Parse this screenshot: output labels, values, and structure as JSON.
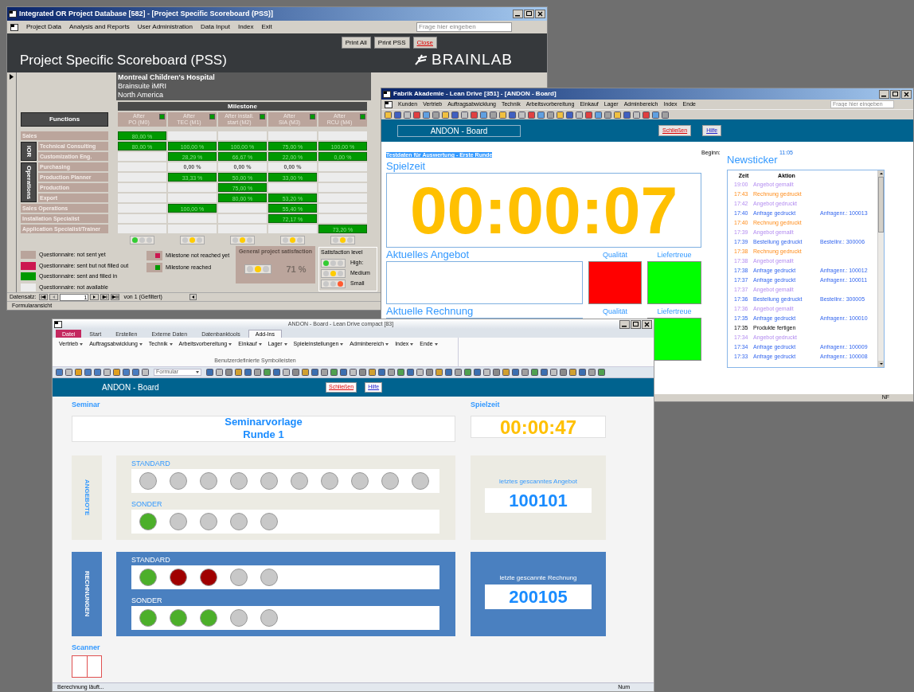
{
  "pss_window": {
    "title": "Integrated OR Project Database [582] - [Project Specific Scoreboard (PSS)]",
    "menu": [
      "Project Data",
      "Analysis and Reports",
      "User Administration",
      "Data Input",
      "Index",
      "Exit"
    ],
    "help_placeholder": "Frage hier eingeben",
    "buttons": [
      {
        "label": "Print All",
        "kind": "normal"
      },
      {
        "label": "Print PSS",
        "kind": "normal"
      },
      {
        "label": "Close",
        "kind": "close"
      }
    ],
    "heading": "Project Specific Scoreboard (PSS)",
    "logo": "BRAINLAB",
    "project": [
      "Montreal Children's Hospital",
      "Brainsuite iMRI",
      "North America"
    ],
    "milestone_header": "Milestone",
    "functions_header": "Functions",
    "milestones": [
      {
        "lines": [
          "After",
          "PO (M0)"
        ],
        "reached": true,
        "lights": [
          {
            "color": "#33cc33"
          },
          {
            "color": "#c8c8c8"
          },
          {
            "color": "#c8c8c8"
          }
        ]
      },
      {
        "lines": [
          "After",
          "TEC (M1)"
        ],
        "reached": true,
        "lights": [
          {
            "color": "#c8c8c8"
          },
          {
            "color": "#ffcc00"
          },
          {
            "color": "#c8c8c8"
          }
        ]
      },
      {
        "lines": [
          "After install.",
          "start (M2)"
        ],
        "reached": true,
        "lights": [
          {
            "color": "#c8c8c8"
          },
          {
            "color": "#ffcc00"
          },
          {
            "color": "#c8c8c8"
          }
        ]
      },
      {
        "lines": [
          "After",
          "SIA (M3)"
        ],
        "reached": true,
        "lights": [
          {
            "color": "#c8c8c8"
          },
          {
            "color": "#ffcc00"
          },
          {
            "color": "#c8c8c8"
          }
        ]
      },
      {
        "lines": [
          "After",
          "RCU (M4)"
        ],
        "reached": true,
        "lights": [
          {
            "color": "#c8c8c8"
          },
          {
            "color": "#ffcc00"
          },
          {
            "color": "#c8c8c8"
          }
        ]
      }
    ],
    "functions": [
      {
        "kind": "row",
        "label": "Sales",
        "cells": [
          {
            "color": "#009900",
            "text": "80,00 %"
          },
          {
            "color": "#ececec"
          },
          {
            "color": "#ececec"
          },
          {
            "color": "#ececec"
          },
          {
            "color": "#ececec"
          }
        ]
      },
      {
        "kind": "group",
        "label": "IOR",
        "children": [
          {
            "kind": "row",
            "label": "Technical Consulting",
            "cells": [
              {
                "color": "#009900",
                "text": "80,00 %"
              },
              {
                "color": "#009900",
                "text": "100,00 %"
              },
              {
                "color": "#009900",
                "text": "100,00 %"
              },
              {
                "color": "#009900",
                "text": "75,00 %"
              },
              {
                "color": "#009900",
                "text": "100,00 %"
              }
            ]
          },
          {
            "kind": "row",
            "label": "Customization Eng.",
            "cells": [
              {
                "color": "#ececec"
              },
              {
                "color": "#009900",
                "text": "28,29 %"
              },
              {
                "color": "#009900",
                "text": "66,67 %"
              },
              {
                "color": "#009900",
                "text": "22,00 %"
              },
              {
                "color": "#009900",
                "text": "0,00 %"
              }
            ]
          }
        ]
      },
      {
        "kind": "group",
        "label": "Operations",
        "children": [
          {
            "kind": "row",
            "label": "Purchasing",
            "cells": [
              {
                "color": "#ececec"
              },
              {
                "color": "#ececec",
                "text": "0,00 %"
              },
              {
                "color": "#ececec",
                "text": "0,00 %"
              },
              {
                "color": "#ececec",
                "text": "0,00 %"
              },
              {
                "color": "#ececec"
              }
            ]
          },
          {
            "kind": "row",
            "label": "Production Planner",
            "cells": [
              {
                "color": "#ececec"
              },
              {
                "color": "#009900",
                "text": "33,33 %"
              },
              {
                "color": "#009900",
                "text": "50,00 %"
              },
              {
                "color": "#009900",
                "text": "33,00 %"
              },
              {
                "color": "#ececec"
              }
            ]
          },
          {
            "kind": "row",
            "label": "Production",
            "cells": [
              {
                "color": "#ececec"
              },
              {
                "color": "#ececec"
              },
              {
                "color": "#009900",
                "text": "75,00 %"
              },
              {
                "color": "#ececec"
              },
              {
                "color": "#ececec"
              }
            ]
          },
          {
            "kind": "row",
            "label": "Export",
            "cells": [
              {
                "color": "#ececec"
              },
              {
                "color": "#ececec"
              },
              {
                "color": "#009900",
                "text": "80,00 %"
              },
              {
                "color": "#009900",
                "text": "53,20 %"
              },
              {
                "color": "#ececec"
              }
            ]
          }
        ]
      },
      {
        "kind": "row",
        "label": "Sales Operations",
        "cells": [
          {
            "color": "#ececec"
          },
          {
            "color": "#009900",
            "text": "100,00 %"
          },
          {
            "color": "#ececec"
          },
          {
            "color": "#009900",
            "text": "55,40 %"
          },
          {
            "color": "#ececec"
          }
        ]
      },
      {
        "kind": "row",
        "label": "Installation Specialist",
        "cells": [
          {
            "color": "#ececec"
          },
          {
            "color": "#ececec"
          },
          {
            "color": "#ececec"
          },
          {
            "color": "#009900",
            "text": "72,17 %"
          },
          {
            "color": "#ececec"
          }
        ]
      },
      {
        "kind": "row",
        "label": "Application Specialist/Trainer",
        "cells": [
          {
            "color": "#ececec"
          },
          {
            "color": "#ececec"
          },
          {
            "color": "#ececec"
          },
          {
            "color": "#ececec"
          },
          {
            "color": "#009900",
            "text": "73,20 %"
          }
        ]
      }
    ],
    "legend": [
      {
        "color": "#b9a49b",
        "text": "Questionnaire: not sent yet"
      },
      {
        "color": "#cc1650",
        "text": "Questionnaire: sent but not filled out"
      },
      {
        "color": "#009900",
        "text": "Questionnaire: sent and filled in"
      },
      {
        "color": "#ececec",
        "text": "Questionnaire: not available"
      }
    ],
    "milestone_legend": [
      {
        "color": "#cc1650",
        "text": "Milestone not reached yet"
      },
      {
        "color": "#009900",
        "text": "Milestone reached"
      }
    ],
    "general_satisfaction": {
      "title": "General project satisfaction",
      "lights": [
        {
          "color": "#c8c8c8"
        },
        {
          "color": "#ffcc00"
        },
        {
          "color": "#c8c8c8"
        }
      ],
      "value": "71 %"
    },
    "satisfaction_level": {
      "title": "Satisfaction level",
      "levels": [
        {
          "label": "High:",
          "lights": [
            {
              "color": "#33cc33"
            },
            {
              "color": "#c8c8c8"
            },
            {
              "color": "#c8c8c8"
            }
          ]
        },
        {
          "label": "Medium",
          "lights": [
            {
              "color": "#c8c8c8"
            },
            {
              "color": "#ffcc00"
            },
            {
              "color": "#c8c8c8"
            }
          ]
        },
        {
          "label": "Small",
          "lights": [
            {
              "color": "#c8c8c8"
            },
            {
              "color": "#c8c8c8"
            },
            {
              "color": "#ff5a30"
            }
          ]
        }
      ]
    },
    "record_nav": {
      "label": "Datensatz:",
      "value": "1",
      "total": "von  1 (Gefiltert)"
    },
    "status": "Formularansicht"
  },
  "andon_window": {
    "title": "Fabrik Akademie - Lean Drive [351] - [ANDON - Board]",
    "menu": [
      "Kunden",
      "Vertrieb",
      "Auftragsabwicklung",
      "Technik",
      "Arbeitsvorbereitung",
      "Einkauf",
      "Lager",
      "Adminbereich",
      "Index",
      "Ende"
    ],
    "help_placeholder": "Frage hier eingeben",
    "board_title": "ANDON - Board",
    "buttons": [
      {
        "label": "Schließen",
        "kind": "close"
      },
      {
        "label": "Hilfe",
        "kind": "help"
      }
    ],
    "dataset": "Testdaten für Auswertung - Erste Runde",
    "start_label": "Beginn:",
    "start_time": "11:05",
    "game_time_label": "Spielzeit",
    "game_time": "00:00:07",
    "rows": [
      {
        "label": "Aktuelles Angebot",
        "indicators": [
          {
            "label": "Qualität",
            "color": "#ff0000"
          },
          {
            "label": "Liefertreue",
            "color": "#00ff00"
          }
        ]
      },
      {
        "label": "Aktuelle Rechnung",
        "indicators": [
          {
            "label": "Qualität"
          },
          {
            "label": "Liefertreue",
            "color": "#00ff00"
          }
        ]
      }
    ],
    "news_title": "Newsticker",
    "news_columns": [
      "Zeit",
      "Aktion"
    ],
    "news": [
      {
        "time": "19:00",
        "action": "Angebot gemailt",
        "kind": "offer"
      },
      {
        "time": "17:43",
        "action": "Rechnung gedruckt",
        "kind": "invoice"
      },
      {
        "time": "17:42",
        "action": "Angebot gedruckt",
        "kind": "offer"
      },
      {
        "time": "17:40",
        "action": "Anfrage gedruckt",
        "ref": "Anfragenr.: 100013",
        "kind": "order"
      },
      {
        "time": "17:40",
        "action": "Rechnung gedruckt",
        "kind": "invoice"
      },
      {
        "time": "17:39",
        "action": "Angebot gemailt",
        "kind": "offer"
      },
      {
        "time": "17:39",
        "action": "Bestellung gedruckt",
        "ref": "Bestellnr.: 300006",
        "kind": "order"
      },
      {
        "time": "17:38",
        "action": "Rechnung gedruckt",
        "kind": "invoice"
      },
      {
        "time": "17:38",
        "action": "Angebot gemailt",
        "kind": "offer"
      },
      {
        "time": "17:38",
        "action": "Anfrage gedruckt",
        "ref": "Anfragenr.: 100012",
        "kind": "order"
      },
      {
        "time": "17:37",
        "action": "Anfrage gedruckt",
        "ref": "Anfragenr.: 100011",
        "kind": "order"
      },
      {
        "time": "17:37",
        "action": "Angebot gemailt",
        "kind": "offer"
      },
      {
        "time": "17:36",
        "action": "Bestellung gedruckt",
        "ref": "Bestellnr.: 300005",
        "kind": "order"
      },
      {
        "time": "17:36",
        "action": "Angebot gemailt",
        "kind": "offer"
      },
      {
        "time": "17:35",
        "action": "Anfrage gedruckt",
        "ref": "Anfragenr.: 100010",
        "kind": "order"
      },
      {
        "time": "17:35",
        "action": "Produkte fertigen",
        "kind": "production"
      },
      {
        "time": "17:34",
        "action": "Angebot gedruckt",
        "kind": "offer"
      },
      {
        "time": "17:34",
        "action": "Anfrage gedruckt",
        "ref": "Anfragenr.: 100009",
        "kind": "order"
      },
      {
        "time": "17:33",
        "action": "Anfrage gedruckt",
        "ref": "Anfragenr.: 100008",
        "kind": "order"
      }
    ],
    "status": "NF"
  },
  "compact_window": {
    "title": "ANDON - Board - Lean Drive compact [83]",
    "tabs": [
      {
        "label": "Datei",
        "kind": "file",
        "selected": false
      },
      {
        "label": "Start",
        "kind": "tab",
        "selected": false
      },
      {
        "label": "Erstellen",
        "kind": "tab",
        "selected": false
      },
      {
        "label": "Externe Daten",
        "kind": "tab",
        "selected": false
      },
      {
        "label": "Datenbanktools",
        "kind": "tab",
        "selected": false
      },
      {
        "label": "Add-Ins",
        "kind": "tab",
        "selected": true
      }
    ],
    "ribbon": [
      "Vertrieb",
      "Auftragsabwicklung",
      "Technik",
      "Arbeitsvorbereitung",
      "Einkauf",
      "Lager",
      "Spieleinstellungen",
      "Adminbereich",
      "Index",
      "Ende"
    ],
    "ribbon_group": "Benutzerdefinierte Symbolleisten",
    "format_dropdown": "Formular",
    "board_title": "ANDON - Board",
    "buttons": [
      {
        "label": "Schließen",
        "kind": "close"
      },
      {
        "label": "Hilfe",
        "kind": "help"
      }
    ],
    "seminar_label": "Seminar",
    "seminar_lines": [
      "Seminarvorlage",
      "Runde 1"
    ],
    "game_time_label": "Spielzeit",
    "game_time": "00:00:47",
    "panels": [
      {
        "kind": "offers",
        "side_label": "ANGEBOTE",
        "groups": [
          {
            "label": "STANDARD",
            "dots": [
              {
                "color": "#c8c8c8"
              },
              {
                "color": "#c8c8c8"
              },
              {
                "color": "#c8c8c8"
              },
              {
                "color": "#c8c8c8"
              },
              {
                "color": "#c8c8c8"
              },
              {
                "color": "#c8c8c8"
              },
              {
                "color": "#c8c8c8"
              },
              {
                "color": "#c8c8c8"
              },
              {
                "color": "#c8c8c8"
              },
              {
                "color": "#c8c8c8"
              }
            ]
          },
          {
            "label": "SONDER",
            "dots": [
              {
                "color": "#4caf2a"
              },
              {
                "color": "#c8c8c8"
              },
              {
                "color": "#c8c8c8"
              },
              {
                "color": "#c8c8c8"
              },
              {
                "color": "#c8c8c8"
              }
            ]
          }
        ],
        "scan_label": "letztes gescanntes Angebot",
        "scan_value": "100101"
      },
      {
        "kind": "invoices",
        "side_label": "RECHNUNGEN",
        "groups": [
          {
            "label": "STANDARD",
            "dots": [
              {
                "color": "#4caf2a"
              },
              {
                "color": "#a00000"
              },
              {
                "color": "#a00000"
              },
              {
                "color": "#c8c8c8"
              },
              {
                "color": "#c8c8c8"
              }
            ]
          },
          {
            "label": "SONDER",
            "dots": [
              {
                "color": "#4caf2a"
              },
              {
                "color": "#4caf2a"
              },
              {
                "color": "#4caf2a"
              },
              {
                "color": "#c8c8c8"
              },
              {
                "color": "#c8c8c8"
              }
            ]
          }
        ],
        "scan_label": "letzte gescannte Rechnung",
        "scan_value": "200105"
      }
    ],
    "scanner_label": "Scanner",
    "status": "Berechnung läuft...",
    "status_right": "Num"
  }
}
